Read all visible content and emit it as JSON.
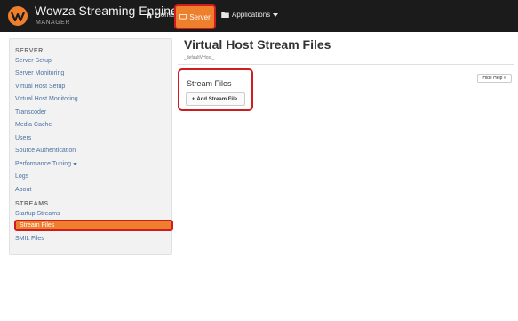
{
  "brand": {
    "name": "Wowza Streaming Engine",
    "sub": "MANAGER"
  },
  "topnav": {
    "home": "Home",
    "server": "Server",
    "applications": "Applications"
  },
  "sidebar": {
    "server_title": "SERVER",
    "server_items": [
      "Server Setup",
      "Server Monitoring",
      "Virtual Host Setup",
      "Virtual Host Monitoring",
      "Transcoder",
      "Media Cache",
      "Users",
      "Source Authentication",
      "Performance Tuning",
      "Logs",
      "About"
    ],
    "streams_title": "STREAMS",
    "streams_items": [
      "Startup Streams",
      "Stream Files",
      "SMIL Files"
    ]
  },
  "main": {
    "title": "Virtual Host Stream Files",
    "vhost": "_defaultVHost_",
    "hide_help": "Hide Help »",
    "section_heading": "Stream Files",
    "add_button": "Add Stream File"
  },
  "colors": {
    "topbar": "#1b1b1b",
    "accent": "#ee7f2d",
    "highlight_border": "#d01c1f",
    "link": "#4a72a3"
  },
  "icons": [
    "wowza-logo-icon",
    "home-icon",
    "monitor-icon",
    "folder-icon",
    "caret-down-icon",
    "plus-icon"
  ]
}
